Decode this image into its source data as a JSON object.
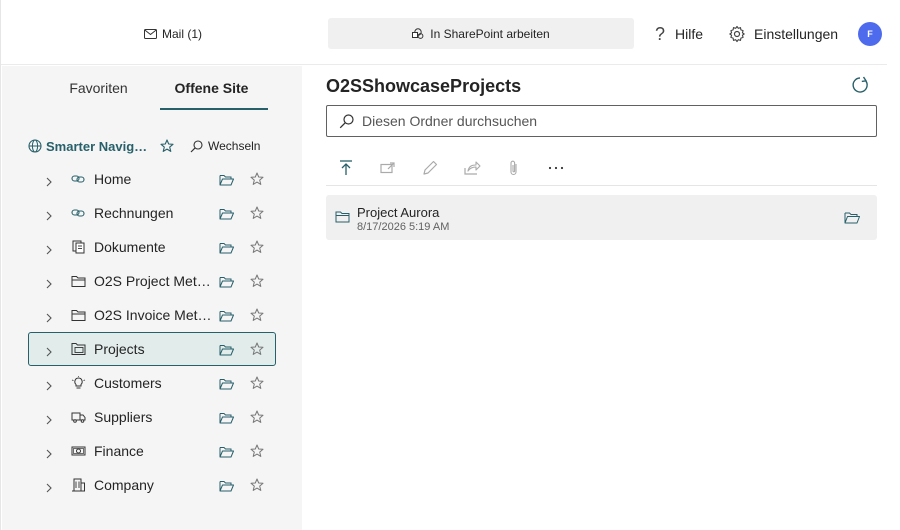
{
  "topbar": {
    "mail_label": "Mail (1)",
    "sharepoint_label": "In SharePoint arbeiten",
    "help_label": "Hilfe",
    "help_glyph": "?",
    "settings_label": "Einstellungen",
    "avatar_initial": "F",
    "avatar_color": "#4f6bed"
  },
  "sidebar": {
    "tabs": [
      {
        "label": "Favoriten",
        "active": false
      },
      {
        "label": "Offene Site",
        "active": true
      }
    ],
    "site_name": "Smarter Navig…",
    "switch_label": "Wechseln",
    "items": [
      {
        "label": "Home",
        "icon": "link-icon",
        "selected": false
      },
      {
        "label": "Rechnungen",
        "icon": "link-icon",
        "selected": false
      },
      {
        "label": "Dokumente",
        "icon": "document-library-icon",
        "selected": false
      },
      {
        "label": "O2S Project Met…",
        "icon": "folder-icon",
        "selected": false
      },
      {
        "label": "O2S Invoice Met…",
        "icon": "folder-icon",
        "selected": false
      },
      {
        "label": "Projects",
        "icon": "folder-library-icon",
        "selected": true
      },
      {
        "label": "Customers",
        "icon": "lightbulb-icon",
        "selected": false
      },
      {
        "label": "Suppliers",
        "icon": "truck-icon",
        "selected": false
      },
      {
        "label": "Finance",
        "icon": "money-icon",
        "selected": false
      },
      {
        "label": "Company",
        "icon": "building-icon",
        "selected": false
      }
    ]
  },
  "main": {
    "title": "O2SShowcaseProjects",
    "search_placeholder": "Diesen Ordner durchsuchen",
    "toolbar": [
      "upload-icon",
      "move-icon",
      "rename-icon",
      "share-icon",
      "attach-icon",
      "more-icon"
    ],
    "files": [
      {
        "name": "Project Aurora",
        "date": "8/17/2026 5:19 AM"
      }
    ]
  },
  "colors": {
    "accent": "#27606a",
    "selected_bg": "#e2eceb",
    "sidebar_bg": "#f5f5f5"
  }
}
